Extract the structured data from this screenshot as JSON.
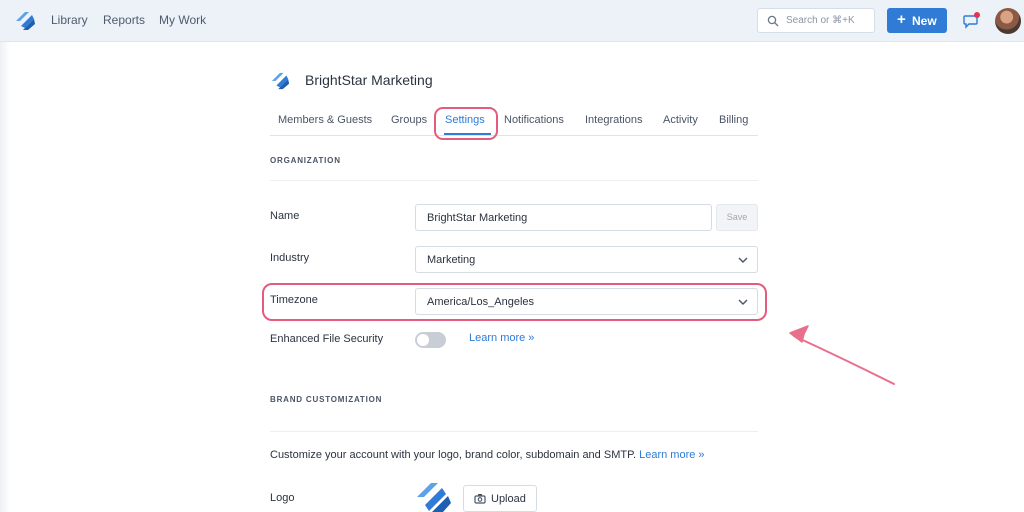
{
  "nav": {
    "items": [
      "Library",
      "Reports",
      "My Work"
    ],
    "search_placeholder": "Search or ⌘+K",
    "new_button": "New",
    "new_plus": "+"
  },
  "org": {
    "name": "BrightStar Marketing"
  },
  "tabs": [
    {
      "label": "Members & Guests"
    },
    {
      "label": "Groups"
    },
    {
      "label": "Settings",
      "active": true
    },
    {
      "label": "Notifications"
    },
    {
      "label": "Integrations"
    },
    {
      "label": "Activity"
    },
    {
      "label": "Billing"
    }
  ],
  "organization": {
    "heading": "ORGANIZATION",
    "name_label": "Name",
    "name_value": "BrightStar Marketing",
    "save_label": "Save",
    "industry_label": "Industry",
    "industry_value": "Marketing",
    "timezone_label": "Timezone",
    "timezone_value": "America/Los_Angeles",
    "security_label": "Enhanced File Security",
    "security_enabled": false,
    "learn_more": "Learn more »"
  },
  "brand": {
    "heading": "BRAND CUSTOMIZATION",
    "description": "Customize your account with your logo, brand color, subdomain and SMTP.",
    "learn_more": "Learn more »",
    "logo_label": "Logo",
    "upload_label": "Upload"
  },
  "colors": {
    "accent": "#2f7bd6",
    "annotation": "#e65b7d",
    "topbar": "#edf2f9"
  }
}
